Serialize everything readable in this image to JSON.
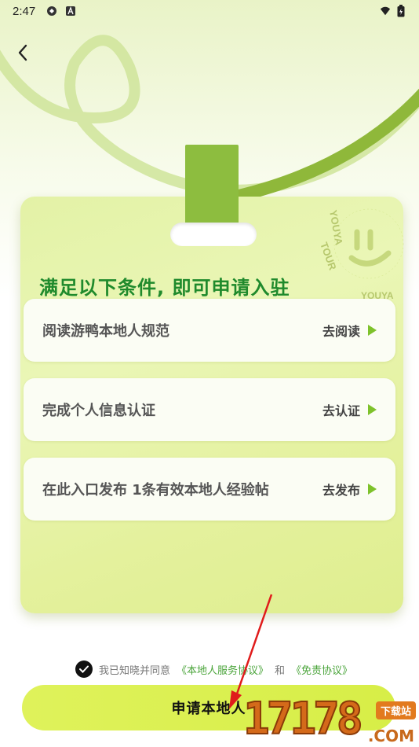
{
  "status_bar": {
    "time": "2:47"
  },
  "page": {
    "title": "满足以下条件, 即可申请入驻",
    "stamp_text": "YOUYA TOUR YOUYA"
  },
  "tasks": [
    {
      "label": "阅读游鸭本地人规范",
      "action": "去阅读"
    },
    {
      "label": "完成个人信息认证",
      "action": "去认证"
    },
    {
      "label": "在此入口发布 1条有效本地人经验帖",
      "action": "去发布"
    }
  ],
  "agreement": {
    "prefix": "我已知晓并同意",
    "link1": "《本地人服务协议》",
    "connector": "和",
    "link2": "《免责协议》"
  },
  "apply_button": {
    "label": "申请本地人"
  },
  "watermark": {
    "digits": "17178",
    "badge": "下载站",
    "suffix": ".COM"
  },
  "colors": {
    "accent": "#7ec22b",
    "title_green": "#1f8a2c",
    "button": "#dbf04f"
  }
}
